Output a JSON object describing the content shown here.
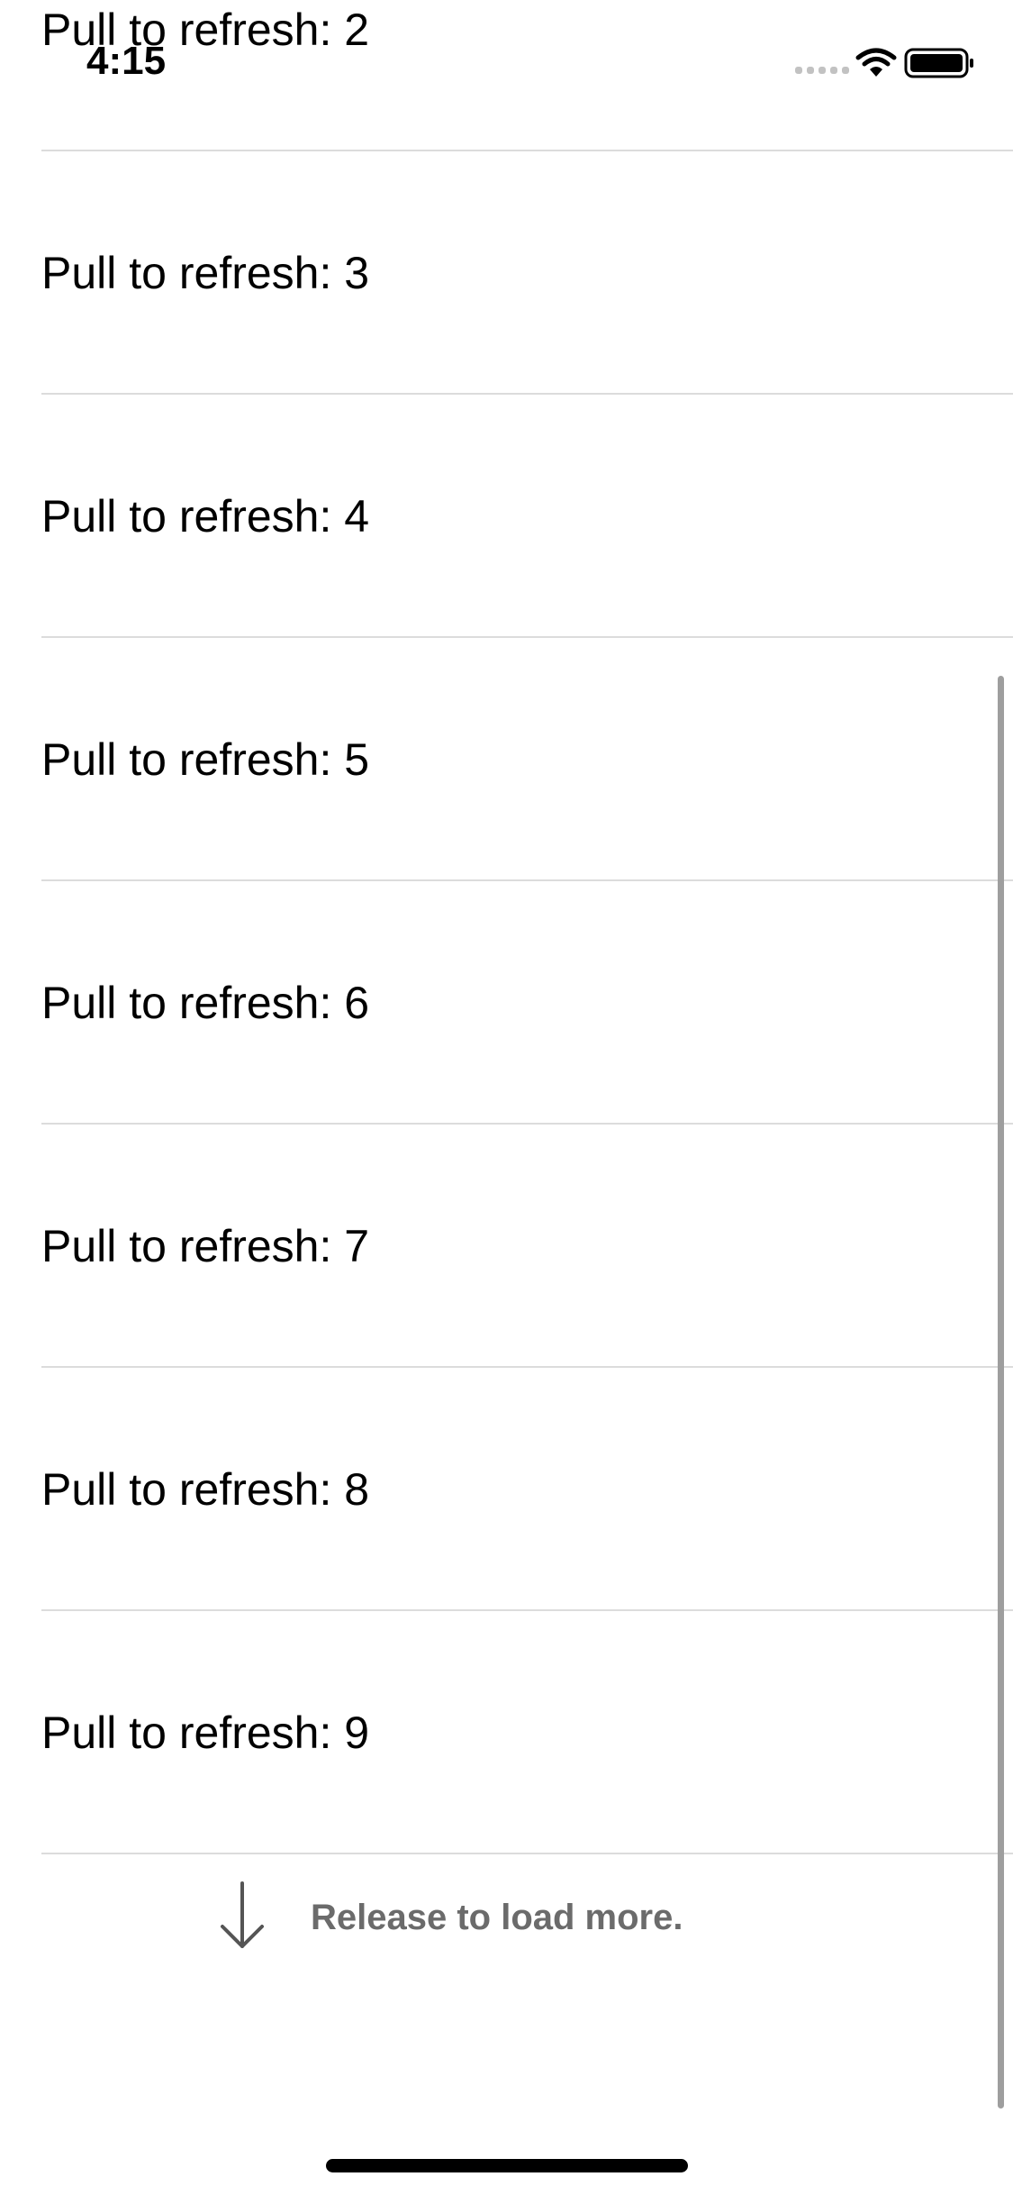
{
  "status_bar": {
    "time": "4:15",
    "icons": [
      "signal-dots-icon",
      "wifi-icon",
      "battery-icon"
    ]
  },
  "list": {
    "items": [
      {
        "label": "Pull to refresh: 2"
      },
      {
        "label": "Pull to refresh: 3"
      },
      {
        "label": "Pull to refresh: 4"
      },
      {
        "label": "Pull to refresh: 5"
      },
      {
        "label": "Pull to refresh: 6"
      },
      {
        "label": "Pull to refresh: 7"
      },
      {
        "label": "Pull to refresh: 8"
      },
      {
        "label": "Pull to refresh: 9"
      }
    ]
  },
  "footer": {
    "text": "Release to load more.",
    "icon": "arrow-down-icon"
  },
  "colors": {
    "separator": "#dcdcdc",
    "footer_text": "#6b6b6b",
    "scrollbar": "#9e9e9e"
  }
}
